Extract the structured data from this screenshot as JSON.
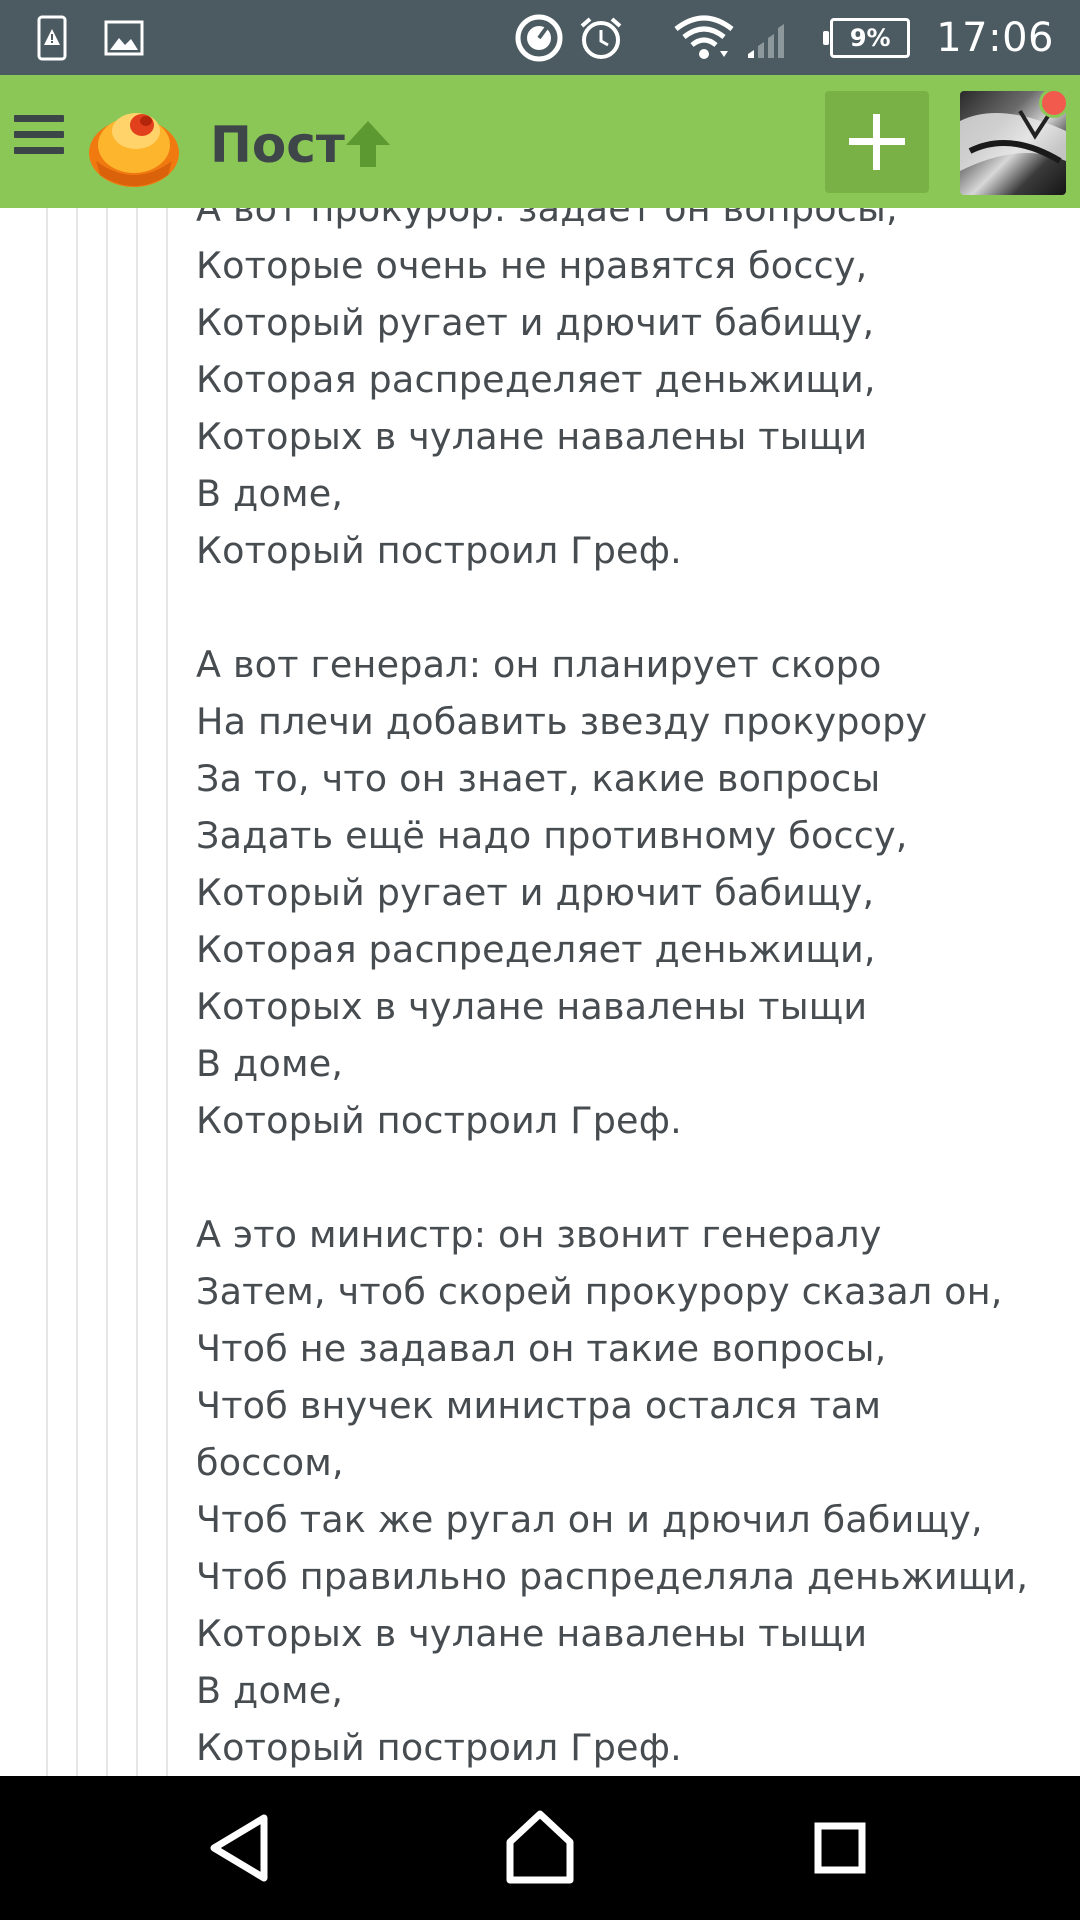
{
  "status_bar": {
    "time": "17:06",
    "battery": "9%",
    "icons": [
      "sim-alert-icon",
      "gallery-icon",
      "data-saver-icon",
      "alarm-icon",
      "wifi-icon",
      "signal-icon",
      "battery-icon"
    ]
  },
  "app_bar": {
    "title": "Пост",
    "icons": [
      "menu-icon",
      "pikabu-logo-icon",
      "arrow-up-icon",
      "plus-icon",
      "avatar"
    ],
    "accent_color": "#8bc757",
    "notification_color": "#f25a4e"
  },
  "poem": {
    "stanzas": [
      {
        "lines": [
          "А вот прокурор: задает он вопросы,",
          "Которые очень не нравятся боссу,",
          "Который ругает и дрючит бабищу,",
          "Которая распределяет деньжищи,",
          "Которых в чулане навалены тыщи",
          "В доме,",
          "Который построил Греф."
        ]
      },
      {
        "lines": [
          "А вот генерал: он планирует скоро",
          "На плечи добавить звезду прокурору",
          "За то, что он знает, какие вопросы",
          "Задать ещё надо противному боссу,",
          "Который ругает и дрючит бабищу,",
          "Которая распределяет деньжищи,",
          "Которых в чулане навалены тыщи",
          "В доме,",
          "Который построил Греф."
        ]
      },
      {
        "lines": [
          "А это министр: он звонит генералу",
          "Затем, чтоб скорей прокурору сказал он,",
          "Чтоб не задавал он такие вопросы,",
          "Чтоб внучек министра остался там",
          "боссом,",
          "Чтоб так же ругал он и дрючил бабищу,",
          "Чтоб правильно распределяла деньжищи,",
          "Которых в чулане навалены тыщи",
          "В доме,",
          "Который построил Греф."
        ]
      }
    ]
  },
  "nav_bar": {
    "icons": [
      "back-icon",
      "home-icon",
      "recents-icon"
    ]
  }
}
